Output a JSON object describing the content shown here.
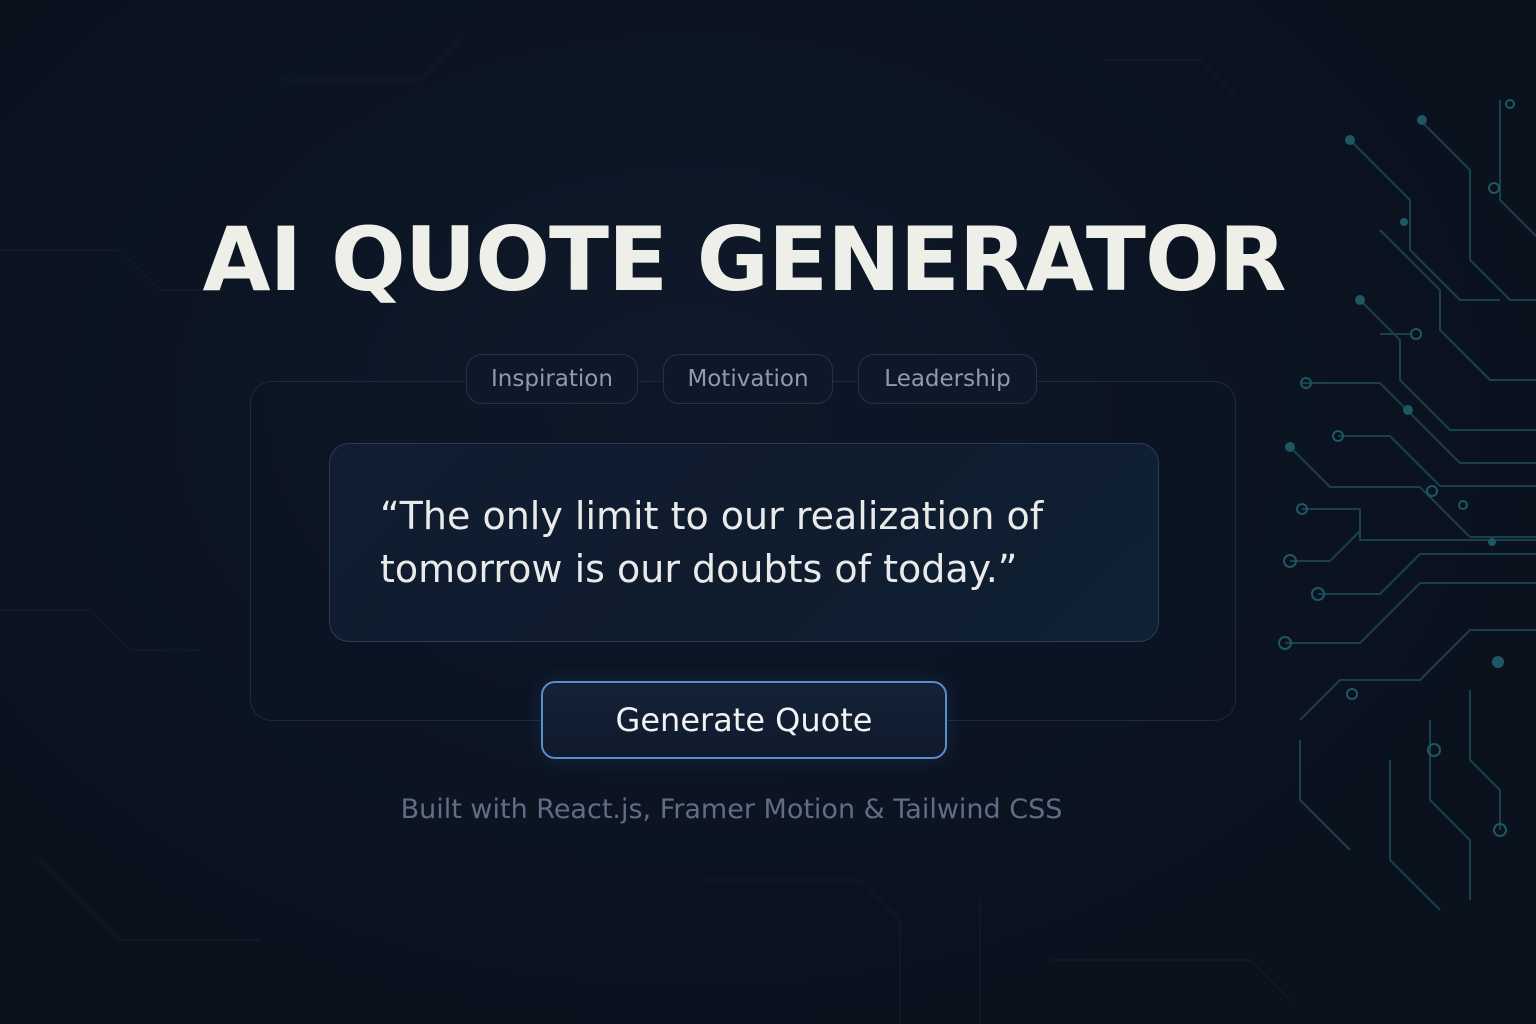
{
  "page": {
    "title": "AI QUOTE GENERATOR"
  },
  "categories": [
    {
      "label": "Inspiration"
    },
    {
      "label": "Motivation"
    },
    {
      "label": "Leadership"
    }
  ],
  "quote": {
    "text": "“The only limit to our realization of tomorrow is our doubts of today.”"
  },
  "actions": {
    "generate_label": "Generate Quote"
  },
  "footer": {
    "credits": "Built with React.js, Framer Motion & Tailwind CSS"
  },
  "colors": {
    "background": "#0c1421",
    "accent": "#5d8ccc",
    "circuit": "#1f5560"
  }
}
